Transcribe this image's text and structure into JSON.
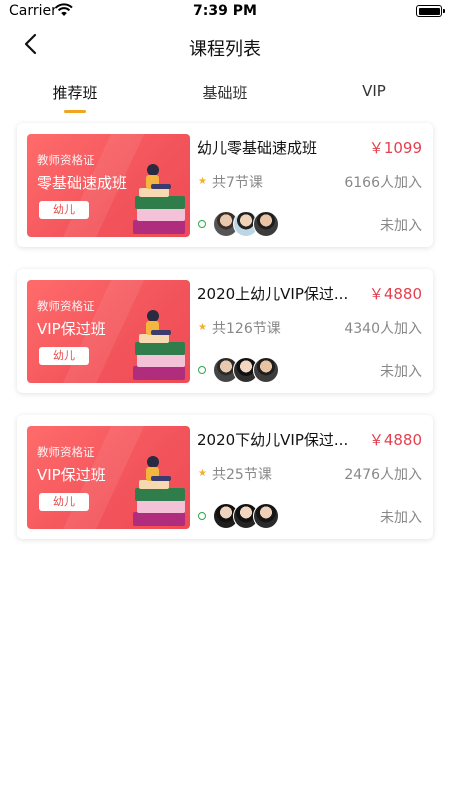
{
  "status_bar": {
    "carrier": "Carrier",
    "time": "7:39 PM"
  },
  "nav": {
    "title": "课程列表"
  },
  "tabs": [
    {
      "label": "推荐班",
      "active": true
    },
    {
      "label": "基础班",
      "active": false
    },
    {
      "label": "VIP",
      "active": false
    }
  ],
  "courses": [
    {
      "thumb_line1": "教师资格证",
      "thumb_line2": "零基础速成班",
      "thumb_badge": "幼儿",
      "title": "幼儿零基础速成班",
      "price": "￥1099",
      "lessons": "共7节课",
      "joined": "6166人加入",
      "status": "未加入"
    },
    {
      "thumb_line1": "教师资格证",
      "thumb_line2": "VIP保过班",
      "thumb_badge": "幼儿",
      "title": "2020上幼儿VIP保过...",
      "price": "￥4880",
      "lessons": "共126节课",
      "joined": "4340人加入",
      "status": "未加入"
    },
    {
      "thumb_line1": "教师资格证",
      "thumb_line2": "VIP保过班",
      "thumb_badge": "幼儿",
      "title": "2020下幼儿VIP保过...",
      "price": "￥4880",
      "lessons": "共25节课",
      "joined": "2476人加入",
      "status": "未加入"
    }
  ],
  "colors": {
    "accent": "#f2a51e",
    "price": "#e5404f",
    "thumb": "#f2545b",
    "online": "#2ca84a"
  }
}
